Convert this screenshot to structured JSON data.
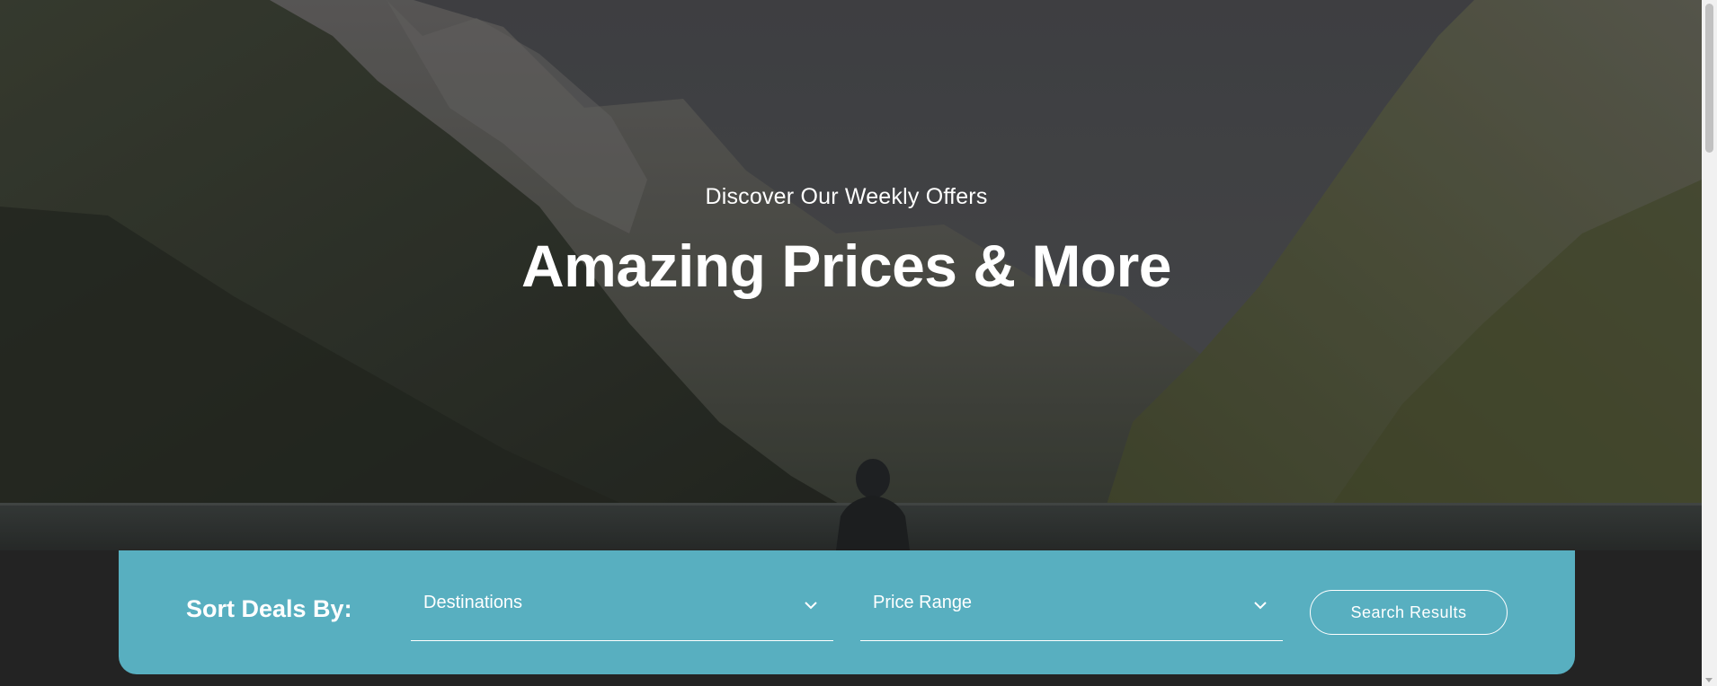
{
  "hero": {
    "subtitle": "Discover Our Weekly Offers",
    "title": "Amazing Prices & More",
    "background_image": "mountain-lake-landscape"
  },
  "filter_bar": {
    "label": "Sort Deals By:",
    "destinations_select": {
      "value": "Destinations",
      "icon": "chevron-down-icon"
    },
    "price_select": {
      "value": "Price Range",
      "icon": "chevron-down-icon"
    },
    "search_button_label": "Search Results"
  },
  "colors": {
    "accent": "#58afc0",
    "page_background": "#232323",
    "text": "#ffffff"
  }
}
